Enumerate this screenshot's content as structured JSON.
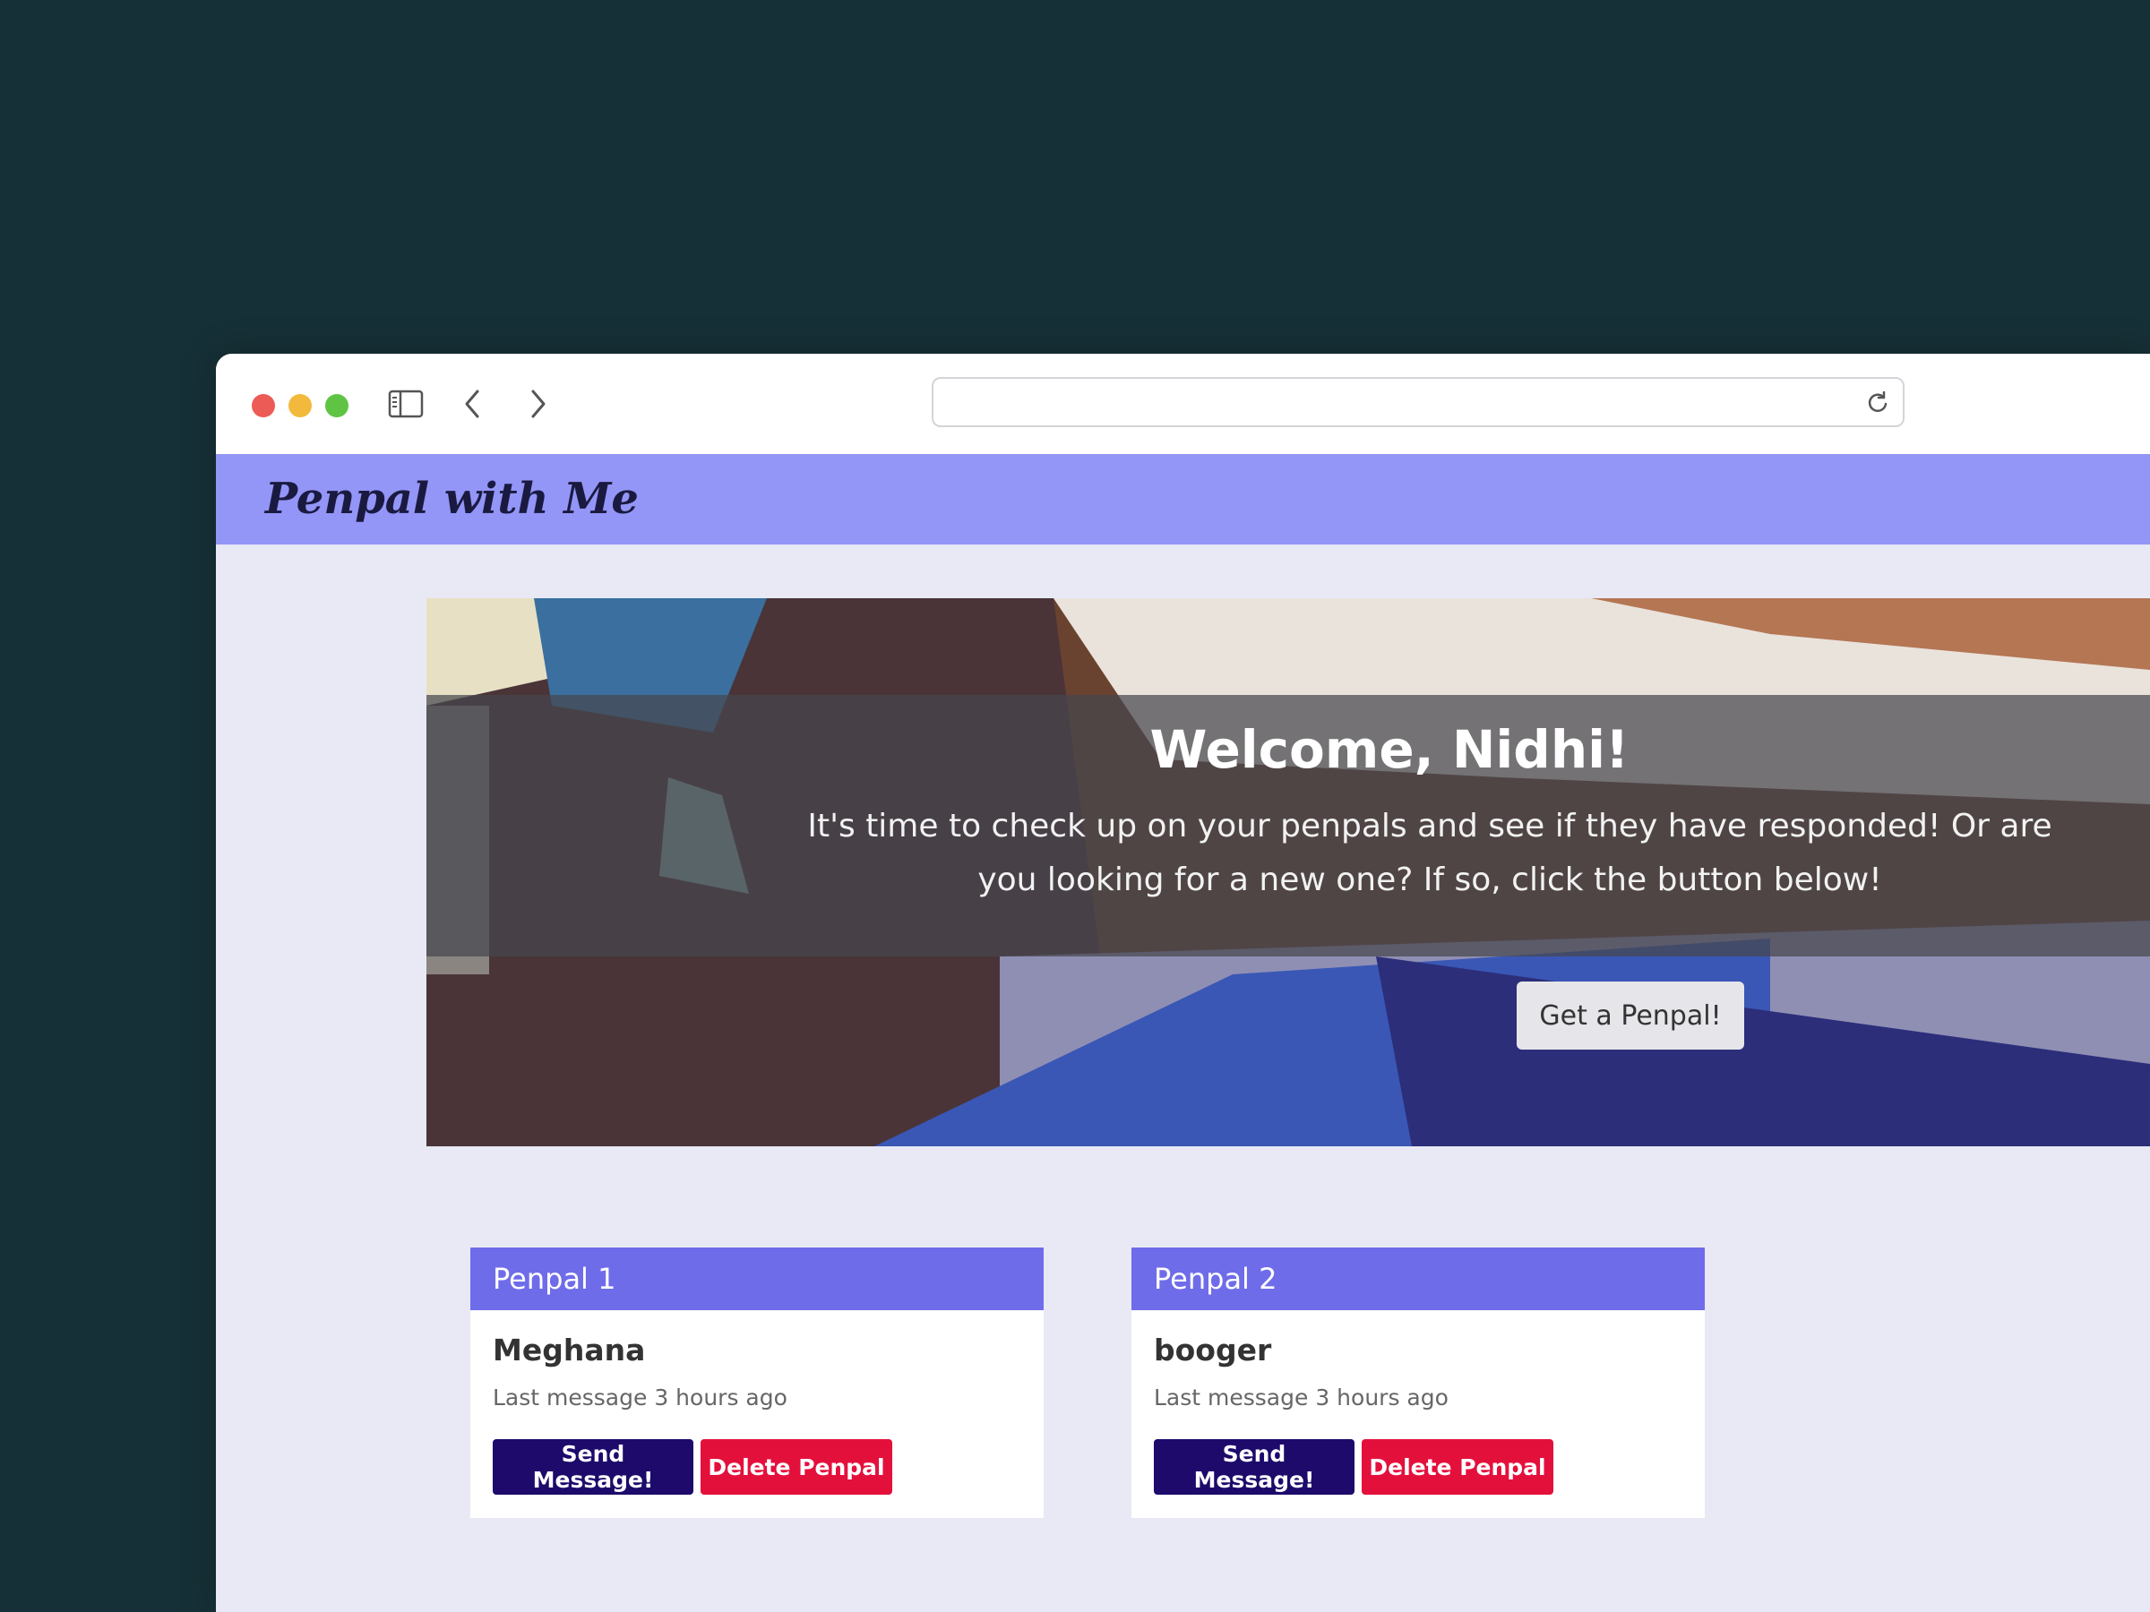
{
  "browser": {
    "url": ""
  },
  "navbar": {
    "brand": "Penpal with Me"
  },
  "hero": {
    "title": "Welcome, Nidhi!",
    "subtitle": "It's time to check up on your penpals and see if they have responded! Or are you looking for a new one? If so, click the button below!",
    "button_label": "Get a Penpal!"
  },
  "penpals": [
    {
      "header": "Penpal 1",
      "name": "Meghana",
      "last_message": "Last message 3 hours ago",
      "send_label": "Send Message!",
      "delete_label": "Delete Penpal"
    },
    {
      "header": "Penpal 2",
      "name": "booger",
      "last_message": "Last message 3 hours ago",
      "send_label": "Send Message!",
      "delete_label": "Delete Penpal"
    }
  ],
  "colors": {
    "background": "#163037",
    "navbar": "#9395f7",
    "card_header": "#6f6cea",
    "send_button": "#1d0a6b",
    "delete_button": "#e4103c"
  }
}
